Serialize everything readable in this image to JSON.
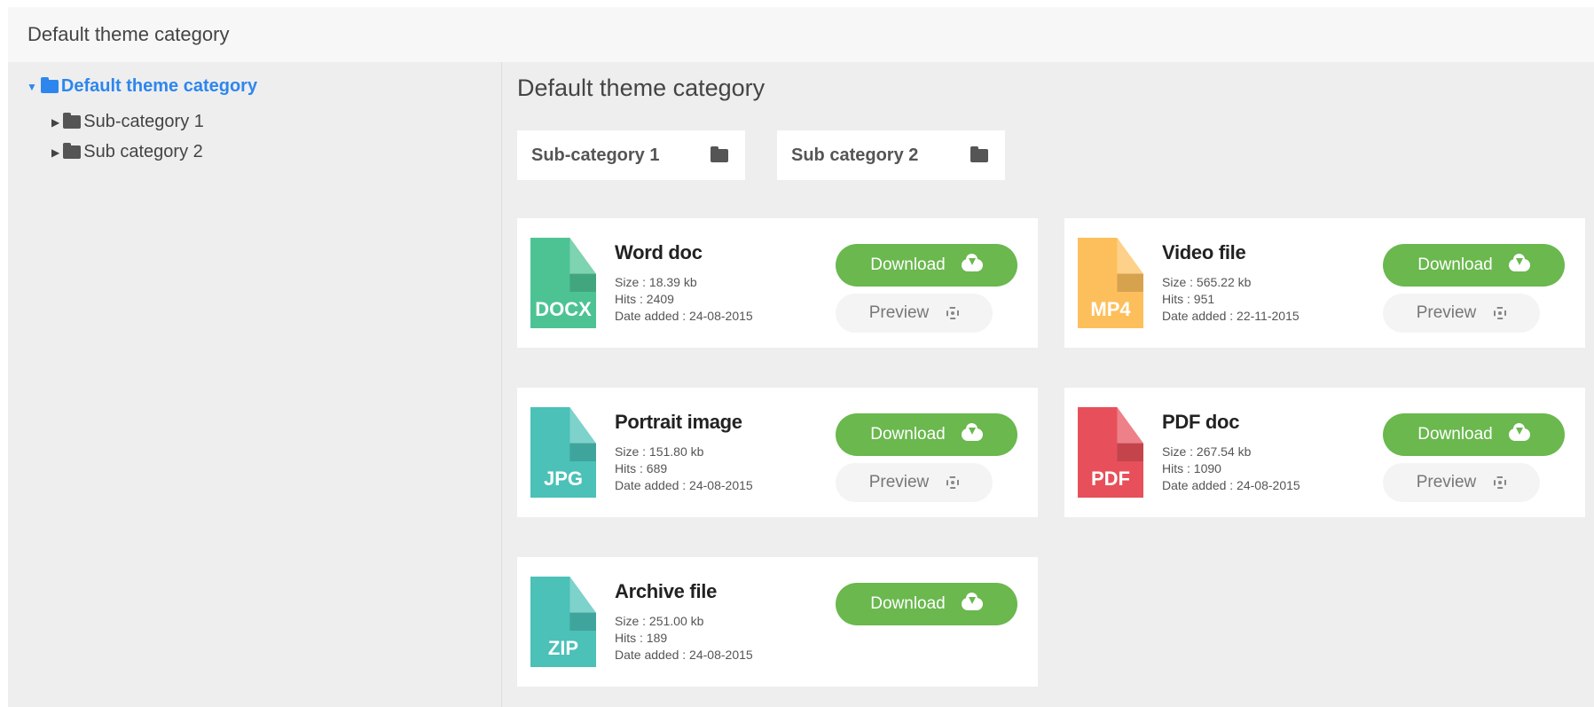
{
  "header": {
    "title": "Default theme category"
  },
  "sidebar": {
    "root_label": "Default theme category",
    "children": [
      {
        "label": "Sub-category 1"
      },
      {
        "label": "Sub category 2"
      }
    ]
  },
  "main": {
    "title": "Default theme category",
    "subcategories": [
      {
        "label": "Sub-category 1"
      },
      {
        "label": "Sub category 2"
      }
    ],
    "files": [
      {
        "title": "Word doc",
        "ext": "DOCX",
        "color": "#4dc394",
        "size": "Size : 18.39 kb",
        "hits": "Hits : 2409",
        "date": "Date added : 24-08-2015",
        "download_label": "Download",
        "preview_label": "Preview"
      },
      {
        "title": "Video file",
        "ext": "MP4",
        "color": "#fdbf5c",
        "size": "Size : 565.22 kb",
        "hits": "Hits : 951",
        "date": "Date added : 22-11-2015",
        "download_label": "Download",
        "preview_label": "Preview"
      },
      {
        "title": "Portrait image",
        "ext": "JPG",
        "color": "#4bc1b8",
        "size": "Size : 151.80 kb",
        "hits": "Hits : 689",
        "date": "Date added : 24-08-2015",
        "download_label": "Download",
        "preview_label": "Preview"
      },
      {
        "title": "PDF doc",
        "ext": "PDF",
        "color": "#e7505a",
        "size": "Size : 267.54 kb",
        "hits": "Hits : 1090",
        "date": "Date added : 24-08-2015",
        "download_label": "Download",
        "preview_label": "Preview"
      },
      {
        "title": "Archive file",
        "ext": "ZIP",
        "color": "#4bc1b8",
        "size": "Size : 251.00 kb",
        "hits": "Hits : 189",
        "date": "Date added : 24-08-2015",
        "download_label": "Download"
      }
    ]
  },
  "colors": {
    "accent": "#2d86ee",
    "download_green": "#6ab84e"
  }
}
